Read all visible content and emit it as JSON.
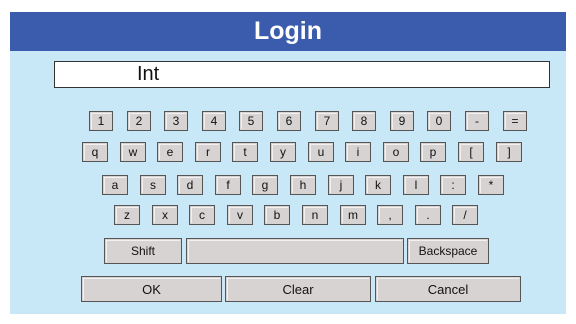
{
  "title": "Login",
  "input": {
    "value": "Int"
  },
  "keyboard": {
    "row1": [
      "1",
      "2",
      "3",
      "4",
      "5",
      "6",
      "7",
      "8",
      "9",
      "0",
      "-",
      "="
    ],
    "row2": [
      "q",
      "w",
      "e",
      "r",
      "t",
      "y",
      "u",
      "i",
      "o",
      "p",
      "[",
      "]"
    ],
    "row3": [
      "a",
      "s",
      "d",
      "f",
      "g",
      "h",
      "j",
      "k",
      "l",
      ":",
      "*"
    ],
    "row4": [
      "z",
      "x",
      "c",
      "v",
      "b",
      "n",
      "m",
      ",",
      ".",
      "/"
    ],
    "shift_label": "Shift",
    "backspace_label": "Backspace",
    "space_label": ""
  },
  "actions": {
    "ok_label": "OK",
    "clear_label": "Clear",
    "cancel_label": "Cancel"
  },
  "colors": {
    "title_bg": "#3b5bac",
    "panel_bg": "#c8e7f7",
    "key_bg": "#d8d3d3"
  }
}
